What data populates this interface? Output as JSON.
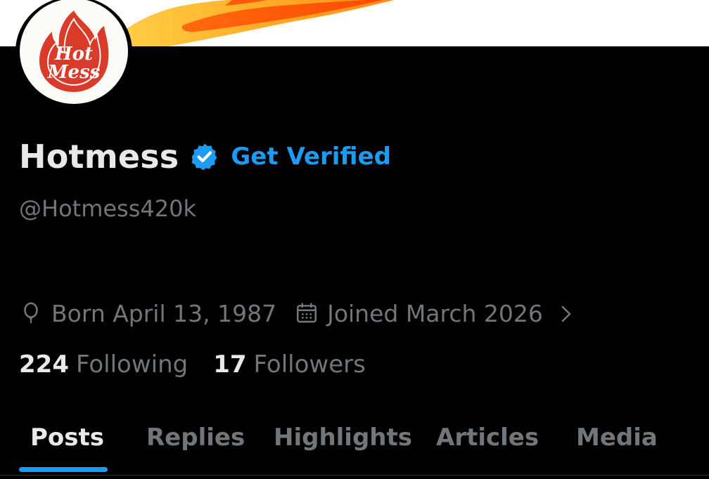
{
  "profile": {
    "avatar_text": [
      "Hot",
      "Mess"
    ],
    "display_name": "Hotmess",
    "verified_icon": "verified-badge-icon",
    "get_verified_label": "Get Verified",
    "handle": "@Hotmess420k",
    "born": "Born April 13, 1987",
    "joined": "Joined March 2026",
    "following_count": "224",
    "following_label": "Following",
    "followers_count": "17",
    "followers_label": "Followers"
  },
  "tabs": [
    {
      "label": "Posts",
      "active": true
    },
    {
      "label": "Replies",
      "active": false
    },
    {
      "label": "Highlights",
      "active": false
    },
    {
      "label": "Articles",
      "active": false
    },
    {
      "label": "Media",
      "active": false
    }
  ],
  "colors": {
    "background": "#000000",
    "primary_text": "#e7e9ea",
    "secondary_text": "#71767b",
    "accent": "#1d9bf0",
    "logo_red": "#d93a2a",
    "flame_orange": "#ff7a1a"
  }
}
